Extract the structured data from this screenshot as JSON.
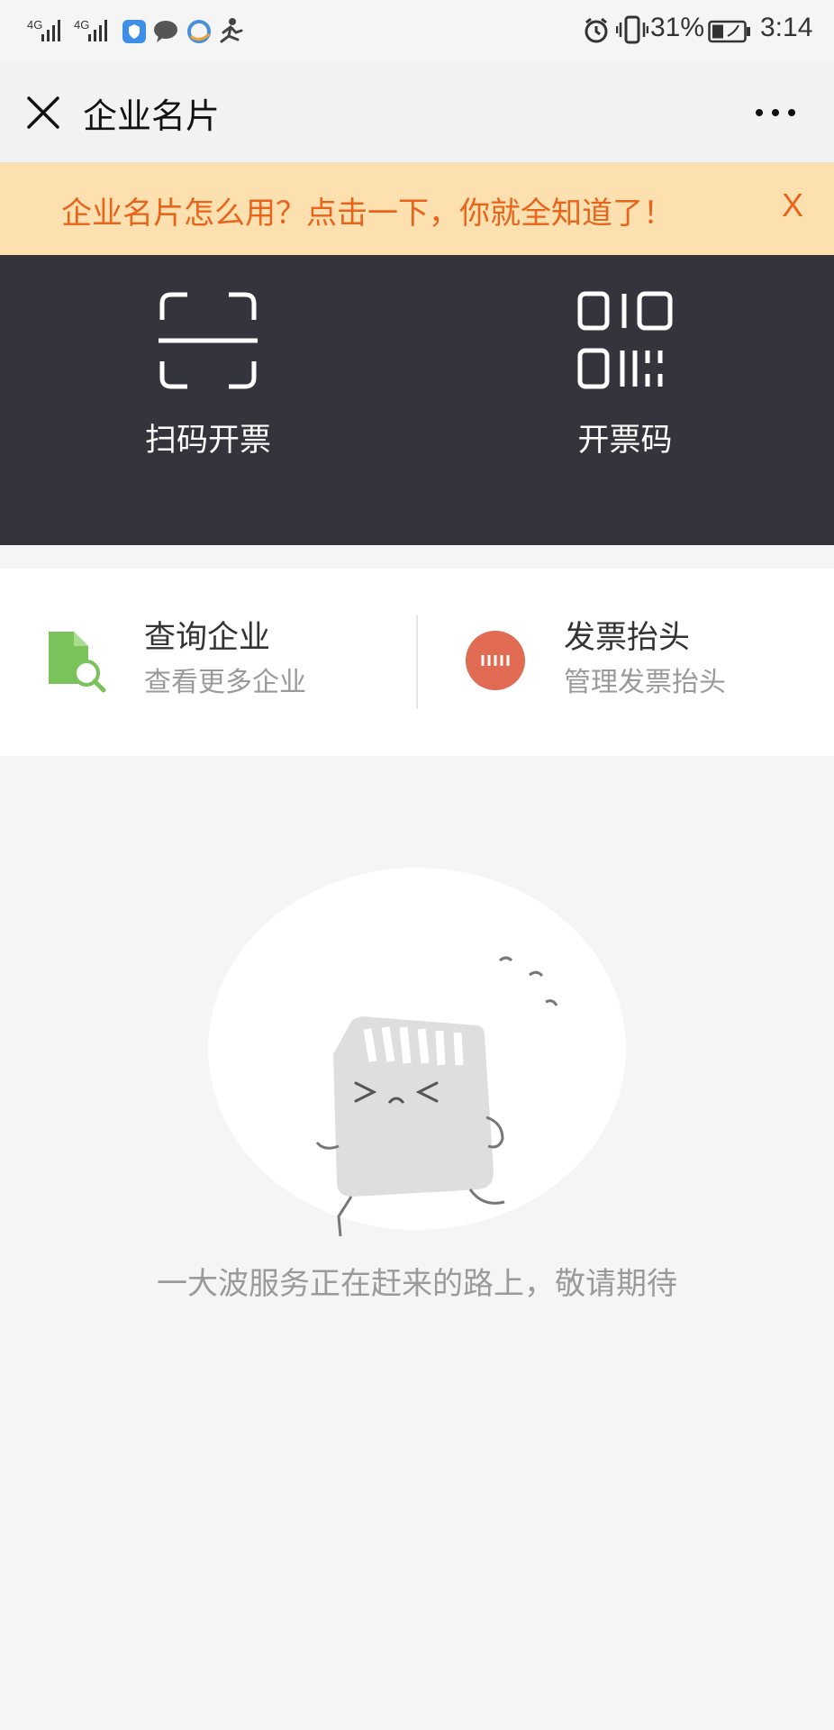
{
  "status_bar": {
    "signal_1": "4G",
    "signal_2": "4G",
    "battery_percent": "31%",
    "time": "3:14"
  },
  "title_bar": {
    "title": "企业名片"
  },
  "notice": {
    "text": "企业名片怎么用？点击一下，你就全知道了！",
    "close_label": "X"
  },
  "actions": [
    {
      "label": "扫码开票",
      "icon": "scan-icon"
    },
    {
      "label": "开票码",
      "icon": "qr-code-icon"
    }
  ],
  "quick_links": [
    {
      "title": "查询企业",
      "subtitle": "查看更多企业",
      "icon": "document-search-icon",
      "color": "#7ac25a"
    },
    {
      "title": "发票抬头",
      "subtitle": "管理发票抬头",
      "icon": "invoice-header-icon",
      "color": "#e06a52"
    }
  ],
  "empty_state": {
    "message": "一大波服务正在赶来的路上，敬请期待",
    "illustration": "running-card-illustration"
  },
  "colors": {
    "notice_bg": "#fde0b0",
    "notice_text": "#e8641a",
    "panel_bg": "#34343c"
  }
}
